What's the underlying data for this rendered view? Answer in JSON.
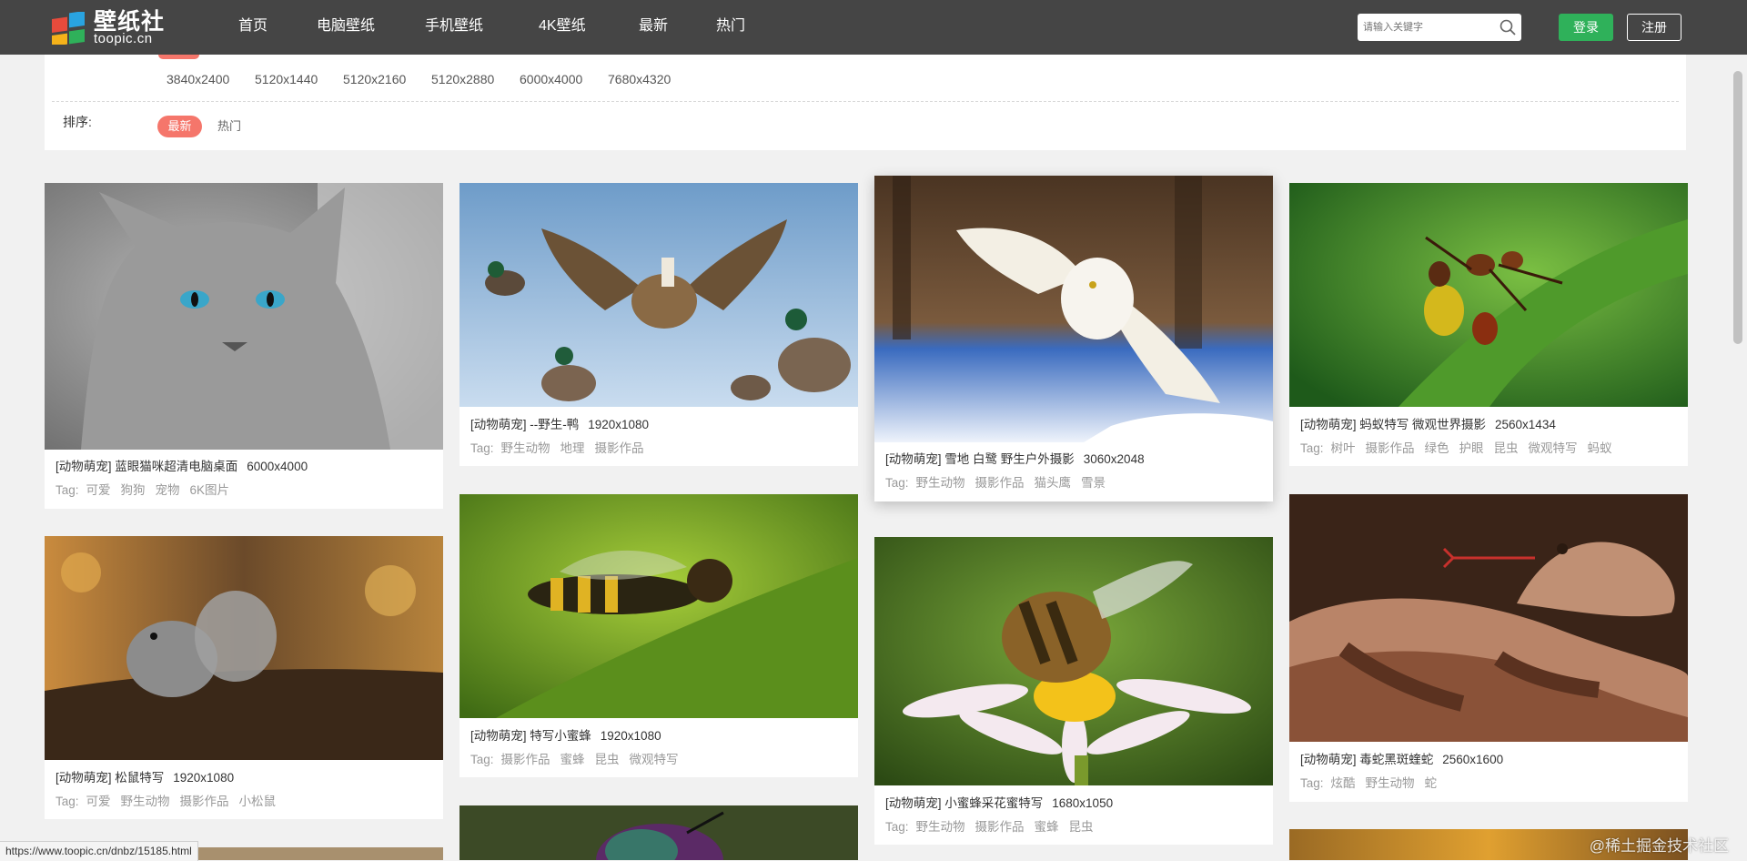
{
  "header": {
    "logo_title": "壁纸社",
    "logo_sub": "toopic.cn",
    "nav": [
      "首页",
      "电脑壁纸",
      "手机壁纸",
      "4K壁纸",
      "最新",
      "热门"
    ],
    "search_placeholder": "请输入关键字",
    "login": "登录",
    "register": "注册"
  },
  "filter": {
    "resolutions": [
      "3840x2400",
      "5120x1440",
      "5120x2160",
      "5120x2880",
      "6000x4000",
      "7680x4320"
    ],
    "sort_label": "排序:",
    "sort_active": "最新",
    "sort_other": "热门"
  },
  "cards": [
    {
      "title": "[动物萌宠] 蓝眼猫咪超清电脑桌面",
      "res": "6000x4000",
      "tags_label": "Tag:",
      "tags": [
        "可爱",
        "狗狗",
        "宠物",
        "6K图片"
      ]
    },
    {
      "title": "[动物萌宠] --野生-鸭",
      "res": "1920x1080",
      "tags_label": "Tag:",
      "tags": [
        "野生动物",
        "地理",
        "摄影作品"
      ]
    },
    {
      "title": "[动物萌宠] 雪地 白鹭 野生户外摄影",
      "res": "3060x2048",
      "tags_label": "Tag:",
      "tags": [
        "野生动物",
        "摄影作品",
        "猫头鹰",
        "雪景"
      ]
    },
    {
      "title": "[动物萌宠] 蚂蚁特写 微观世界摄影",
      "res": "2560x1434",
      "tags_label": "Tag:",
      "tags": [
        "树叶",
        "摄影作品",
        "绿色",
        "护眼",
        "昆虫",
        "微观特写",
        "蚂蚁"
      ]
    },
    {
      "title": "[动物萌宠] 松鼠特写",
      "res": "1920x1080",
      "tags_label": "Tag:",
      "tags": [
        "可爱",
        "野生动物",
        "摄影作品",
        "小松鼠"
      ]
    },
    {
      "title": "[动物萌宠] 特写小蜜蜂",
      "res": "1920x1080",
      "tags_label": "Tag:",
      "tags": [
        "摄影作品",
        "蜜蜂",
        "昆虫",
        "微观特写"
      ]
    },
    {
      "title": "[动物萌宠] 小蜜蜂采花蜜特写",
      "res": "1680x1050",
      "tags_label": "Tag:",
      "tags": [
        "野生动物",
        "摄影作品",
        "蜜蜂",
        "昆虫"
      ]
    },
    {
      "title": "[动物萌宠] 毒蛇黑斑蝰蛇",
      "res": "2560x1600",
      "tags_label": "Tag:",
      "tags": [
        "炫酷",
        "野生动物",
        "蛇"
      ]
    }
  ],
  "status_url": "https://www.toopic.cn/dnbz/15185.html",
  "watermark": "@稀土掘金技术社区"
}
